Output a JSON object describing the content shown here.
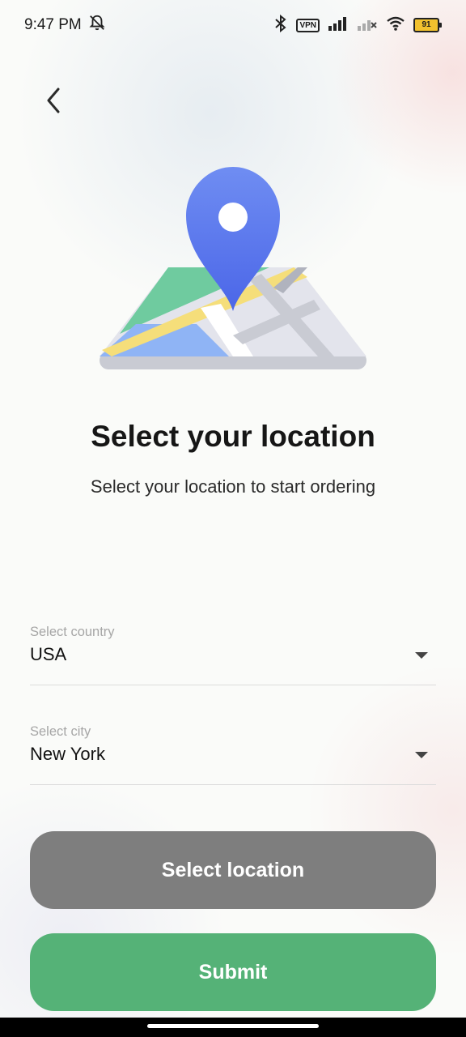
{
  "status_bar": {
    "time": "9:47 PM",
    "vpn_label": "VPN",
    "battery": "91"
  },
  "header": {
    "back_icon": "chevron-left-icon"
  },
  "hero": {
    "title": "Select your location",
    "subtitle": "Select your location to start ordering",
    "pin_color": "#5b7cf0",
    "map_green": "#6fcb9f",
    "map_yellow": "#f5de7a",
    "map_blue": "#8fb4f5"
  },
  "form": {
    "country": {
      "label": "Select country",
      "value": "USA"
    },
    "city": {
      "label": "Select city",
      "value": "New York"
    }
  },
  "buttons": {
    "select_location": "Select location",
    "submit": "Submit"
  },
  "colors": {
    "gray_button": "#7e7e7e",
    "green_button": "#55b277"
  }
}
